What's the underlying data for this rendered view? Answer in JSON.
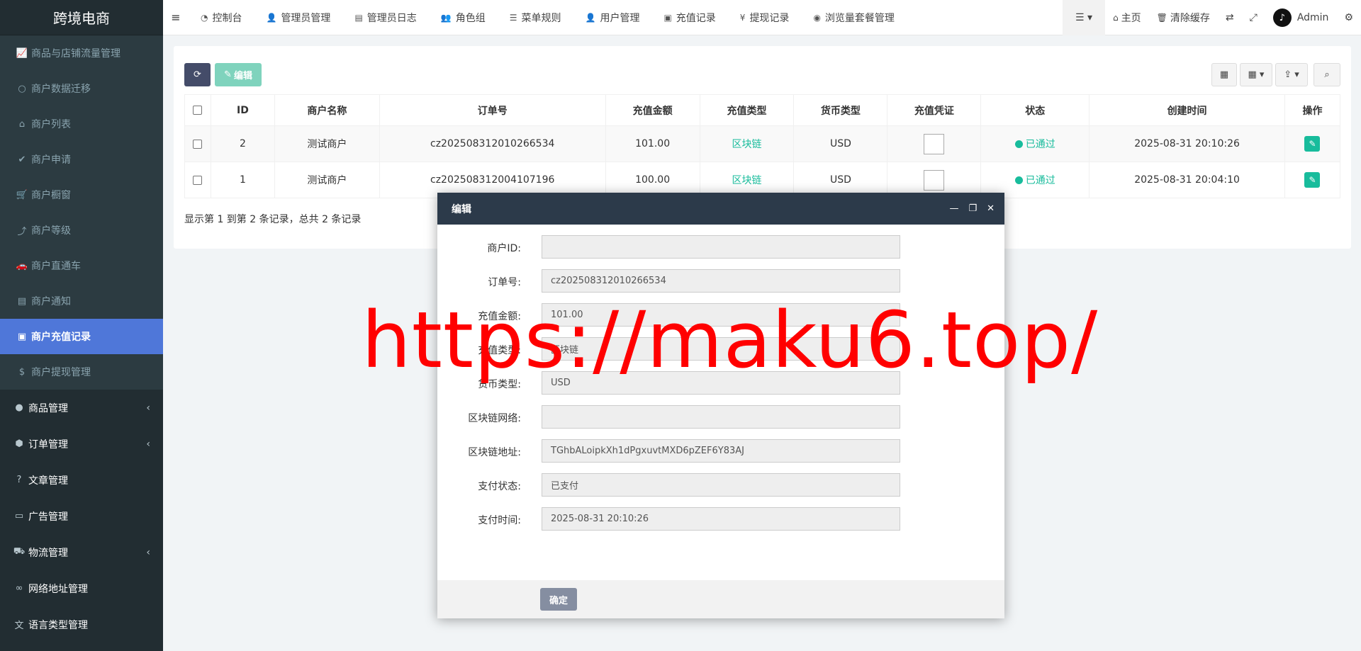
{
  "app": {
    "title": "跨境电商"
  },
  "sidebar": {
    "submenu": [
      {
        "label": "商品与店铺流量管理",
        "icon": "line-chart-icon"
      },
      {
        "label": "商户数据迁移",
        "icon": "circle-icon"
      },
      {
        "label": "商户列表",
        "icon": "home-icon"
      },
      {
        "label": "商户申请",
        "icon": "check-circle-icon"
      },
      {
        "label": "商户橱窗",
        "icon": "cart-icon"
      },
      {
        "label": "商户等级",
        "icon": "level-up-icon"
      },
      {
        "label": "商户直通车",
        "icon": "car-icon"
      },
      {
        "label": "商户通知",
        "icon": "notice-icon"
      },
      {
        "label": "商户充值记录",
        "icon": "money-icon",
        "active": true
      },
      {
        "label": "商户提现管理",
        "icon": "dollar-icon"
      }
    ],
    "menu": [
      {
        "label": "商品管理",
        "icon": "product-icon",
        "chevron": true
      },
      {
        "label": "订单管理",
        "icon": "cube-icon",
        "chevron": true
      },
      {
        "label": "文章管理",
        "icon": "question-icon",
        "chevron": false
      },
      {
        "label": "广告管理",
        "icon": "credit-card-icon",
        "chevron": false
      },
      {
        "label": "物流管理",
        "icon": "truck-icon",
        "chevron": true
      },
      {
        "label": "网络地址管理",
        "icon": "link-icon",
        "chevron": false
      },
      {
        "label": "语言类型管理",
        "icon": "language-icon",
        "chevron": false
      }
    ]
  },
  "topnav": [
    {
      "label": "控制台",
      "icon": "dashboard-icon"
    },
    {
      "label": "管理员管理",
      "icon": "user-icon"
    },
    {
      "label": "管理员日志",
      "icon": "list-alt-icon"
    },
    {
      "label": "角色组",
      "icon": "group-icon"
    },
    {
      "label": "菜单规则",
      "icon": "bars-icon"
    },
    {
      "label": "用户管理",
      "icon": "user-icon"
    },
    {
      "label": "充值记录",
      "icon": "money-icon"
    },
    {
      "label": "提现记录",
      "icon": "yen-icon"
    },
    {
      "label": "浏览量套餐管理",
      "icon": "eye-icon"
    }
  ],
  "topright": {
    "home": "主页",
    "clear_cache": "清除缓存",
    "user": "Admin"
  },
  "toolbar": {
    "edit_label": "编辑"
  },
  "table": {
    "headers": [
      "ID",
      "商户名称",
      "订单号",
      "充值金额",
      "充值类型",
      "货币类型",
      "充值凭证",
      "状态",
      "创建时间",
      "操作"
    ],
    "rows": [
      {
        "id": "2",
        "merchant": "测试商户",
        "order_no": "cz202508312010266534",
        "amount": "101.00",
        "type": "区块链",
        "currency": "USD",
        "status": "已通过",
        "created": "2025-08-31 20:10:26"
      },
      {
        "id": "1",
        "merchant": "测试商户",
        "order_no": "cz202508312004107196",
        "amount": "100.00",
        "type": "区块链",
        "currency": "USD",
        "status": "已通过",
        "created": "2025-08-31 20:04:10"
      }
    ]
  },
  "pager": {
    "text": "显示第 1 到第 2 条记录，总共 2 条记录"
  },
  "modal": {
    "title": "编辑",
    "fields": [
      {
        "label": "商户ID:",
        "value": ""
      },
      {
        "label": "订单号:",
        "value": "cz202508312010266534"
      },
      {
        "label": "充值金额:",
        "value": "101.00"
      },
      {
        "label": "充值类型:",
        "value": "区块链"
      },
      {
        "label": "货币类型:",
        "value": "USD"
      },
      {
        "label": "区块链网络:",
        "value": ""
      },
      {
        "label": "区块链地址:",
        "value": "TGhbALoipkXh1dPgxuvtMXD6pZEF6Y83AJ"
      },
      {
        "label": "支付状态:",
        "value": "已支付"
      },
      {
        "label": "支付时间:",
        "value": "2025-08-31 20:10:26"
      }
    ],
    "ok_label": "确定"
  },
  "watermark": {
    "text": "https://maku6.top/"
  },
  "colors": {
    "sidebar": "#222d32",
    "active": "#4f77d9",
    "teal": "#18bc9c",
    "modal_header": "#2c3a4a"
  }
}
